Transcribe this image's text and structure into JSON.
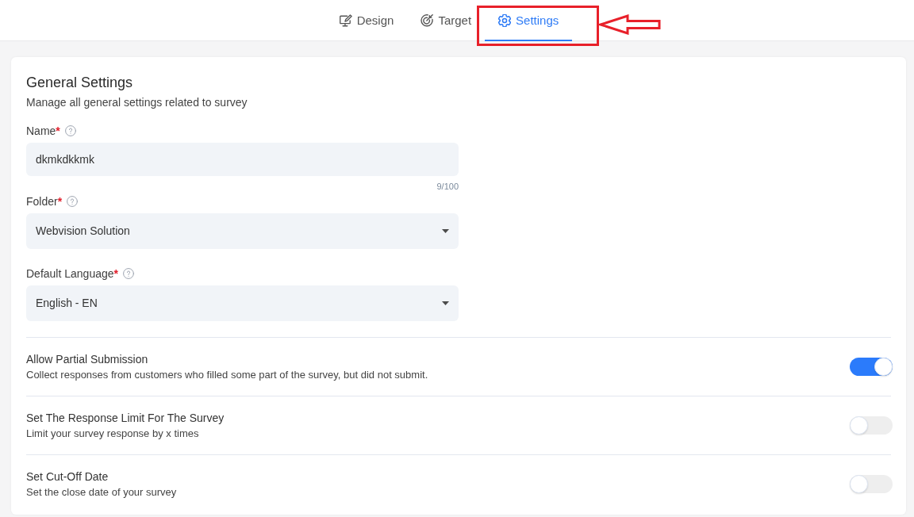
{
  "tabs": [
    {
      "label": "Design",
      "selected": false,
      "annotated": false
    },
    {
      "label": "Target",
      "selected": false,
      "annotated": false
    },
    {
      "label": "Settings",
      "selected": true,
      "annotated": true
    }
  ],
  "general_settings": {
    "title": "General Settings",
    "subtitle": "Manage all general settings related to survey",
    "fields": [
      {
        "kind": "text",
        "label": "Name",
        "required_mark": "*",
        "value": "dkmkdkkmk",
        "counter": "9/100"
      },
      {
        "kind": "select",
        "label": "Folder",
        "required_mark": "*",
        "value": "Webvision Solution"
      },
      {
        "kind": "select",
        "label": "Default Language",
        "required_mark": "*",
        "value": "English - EN"
      }
    ]
  },
  "options": [
    {
      "title": "Allow Partial Submission",
      "description": "Collect responses from customers who filled some part of the survey, but did not submit.",
      "on": true
    },
    {
      "title": "Set The Response Limit For The Survey",
      "description": "Limit your survey response by x times",
      "on": false
    },
    {
      "title": "Set Cut-Off Date",
      "description": "Set the close date of your survey",
      "on": false
    }
  ]
}
